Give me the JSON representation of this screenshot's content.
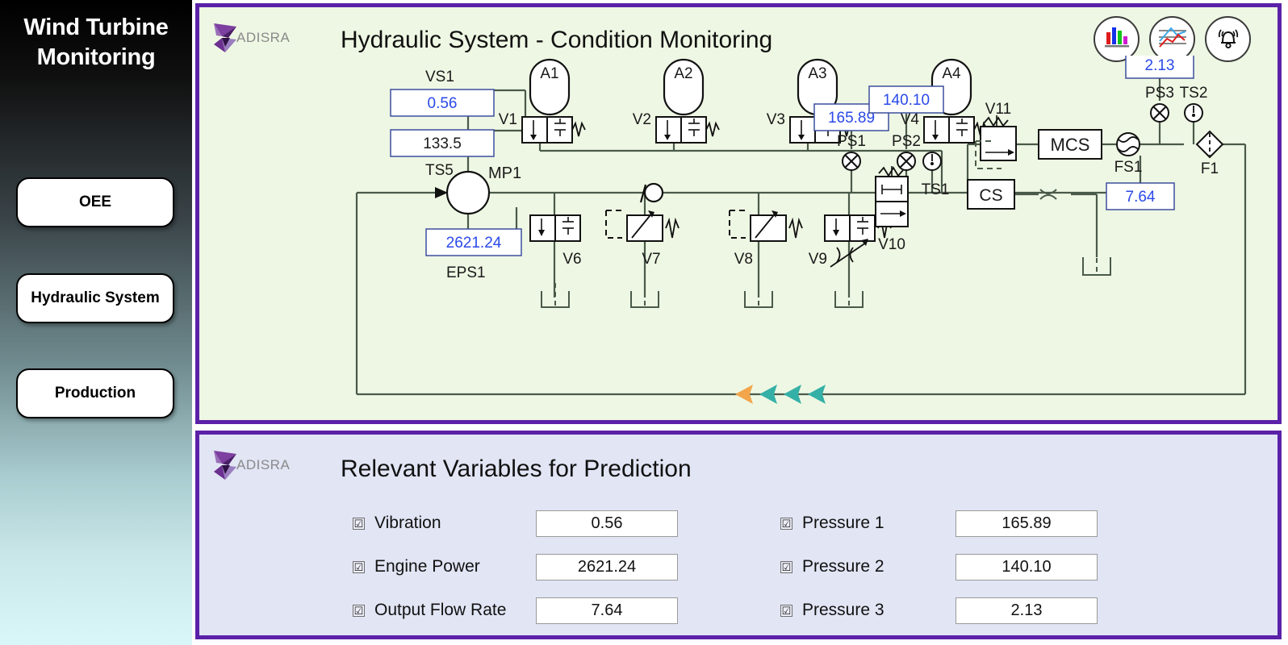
{
  "sidebar": {
    "title": "Wind Turbine Monitoring",
    "buttons": [
      {
        "label": "OEE"
      },
      {
        "label": "Hydraulic System"
      },
      {
        "label": "Production"
      }
    ]
  },
  "brand": {
    "name": "ADISRA"
  },
  "header": {
    "title": "Hydraulic System - Condition Monitoring",
    "icons": [
      {
        "name": "bar-chart-icon",
        "title": "Bar Chart"
      },
      {
        "name": "trend-chart-icon",
        "title": "Trend Chart"
      },
      {
        "name": "alarm-bell-icon",
        "title": "Alarms"
      }
    ]
  },
  "schematic": {
    "readouts": [
      {
        "id": "VS1",
        "value": "0.56",
        "color": "#2a49e8"
      },
      {
        "id": "TS5",
        "value": "133.5",
        "color": "#1a1a1a"
      },
      {
        "id": "EPS1",
        "value": "2621.24",
        "color": "#2a49e8"
      },
      {
        "id": "PS1",
        "value": "165.89",
        "color": "#2a49e8"
      },
      {
        "id": "PS2",
        "value": "140.10",
        "color": "#2a49e8"
      },
      {
        "id": "PS3",
        "value": "2.13",
        "color": "#2a49e8"
      },
      {
        "id": "FS1",
        "value": "7.64",
        "color": "#2a49e8"
      }
    ],
    "labels": {
      "vs1": "VS1",
      "ts5": "TS5",
      "eps1": "EPS1",
      "mp1": "MP1",
      "a1": "A1",
      "a2": "A2",
      "a3": "A3",
      "a4": "A4",
      "v1": "V1",
      "v2": "V2",
      "v3": "V3",
      "v4": "V4",
      "v6": "V6",
      "v7": "V7",
      "v8": "V8",
      "v9": "V9",
      "v10": "V10",
      "v11": "V11",
      "ps1": "PS1",
      "ps2": "PS2",
      "ps3": "PS3",
      "ts1": "TS1",
      "ts2": "TS2",
      "fs1": "FS1",
      "f1": "F1",
      "mcs": "MCS",
      "cs": "CS"
    },
    "flow_arrows": {
      "count": 4,
      "lead_color": "#f2a54a",
      "trail_color": "#35b0a7",
      "direction": "left"
    }
  },
  "prediction": {
    "title": "Relevant Variables for Prediction",
    "left_column": [
      {
        "label": "Vibration",
        "value": "0.56",
        "checked": "☑"
      },
      {
        "label": "Engine Power",
        "value": "2621.24",
        "checked": "☑"
      },
      {
        "label": "Output Flow Rate",
        "value": "7.64",
        "checked": "☑"
      }
    ],
    "right_column": [
      {
        "label": "Pressure 1",
        "value": "165.89",
        "checked": "☑"
      },
      {
        "label": "Pressure 2",
        "value": "140.10",
        "checked": "☑"
      },
      {
        "label": "Pressure 3",
        "value": "2.13",
        "checked": "☑"
      }
    ]
  },
  "colors": {
    "panel_border": "#5b21a8",
    "top_panel_bg": "#eef7e3",
    "bottom_panel_bg": "#e1e5f4",
    "value_blue": "#2a49e8",
    "line": "#4a5a4a"
  }
}
